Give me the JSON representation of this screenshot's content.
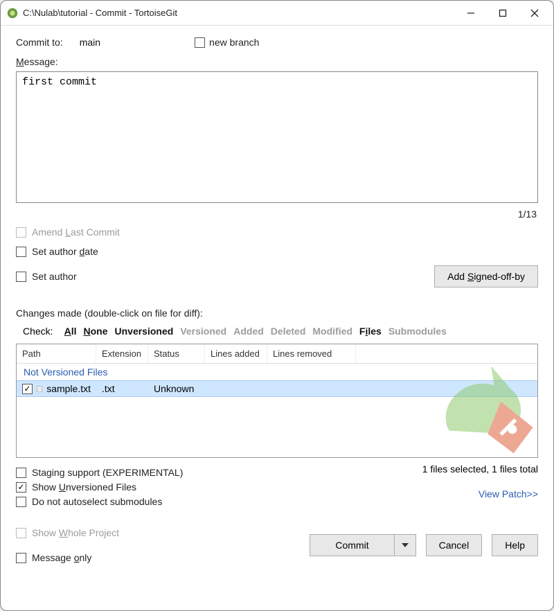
{
  "window": {
    "title": "C:\\Nulab\\tutorial - Commit - TortoiseGit"
  },
  "commit_to": {
    "label": "Commit to:",
    "branch": "main"
  },
  "new_branch": {
    "label": "new branch",
    "checked": false
  },
  "message": {
    "label": "Message:",
    "value": "first commit",
    "charcount": "1/13"
  },
  "amend": {
    "label": "Amend Last Commit",
    "checked": false,
    "disabled": true
  },
  "author_date": {
    "label": "Set author date",
    "checked": false
  },
  "author": {
    "label": "Set author",
    "checked": false
  },
  "signed_off": {
    "button": "Add Signed-off-by"
  },
  "changes_label": "Changes made (double-click on file for diff):",
  "filters": {
    "label": "Check:",
    "items": [
      {
        "text": "All",
        "state": "active"
      },
      {
        "text": "None",
        "state": "active"
      },
      {
        "text": "Unversioned",
        "state": "active"
      },
      {
        "text": "Versioned",
        "state": "boldinactive"
      },
      {
        "text": "Added",
        "state": "boldinactive"
      },
      {
        "text": "Deleted",
        "state": "boldinactive"
      },
      {
        "text": "Modified",
        "state": "boldinactive"
      },
      {
        "text": "Files",
        "state": "active"
      },
      {
        "text": "Submodules",
        "state": "boldinactive"
      }
    ]
  },
  "columns": {
    "path": "Path",
    "ext": "Extension",
    "status": "Status",
    "la": "Lines added",
    "lr": "Lines removed"
  },
  "group_header": "Not Versioned Files",
  "file": {
    "checked": true,
    "name": "sample.txt",
    "ext": ".txt",
    "status": "Unknown",
    "la": "",
    "lr": ""
  },
  "summary": "1 files selected, 1 files total",
  "staging": {
    "label": "Staging support (EXPERIMENTAL)",
    "checked": false
  },
  "show_unv": {
    "label": "Show Unversioned Files",
    "checked": true
  },
  "no_autosel": {
    "label": "Do not autoselect submodules",
    "checked": false
  },
  "view_patch": "View Patch>>",
  "whole_proj": {
    "label": "Show Whole Project",
    "checked": false,
    "disabled": true
  },
  "msg_only": {
    "label": "Message only",
    "checked": false
  },
  "buttons": {
    "commit": "Commit",
    "cancel": "Cancel",
    "help": "Help"
  }
}
